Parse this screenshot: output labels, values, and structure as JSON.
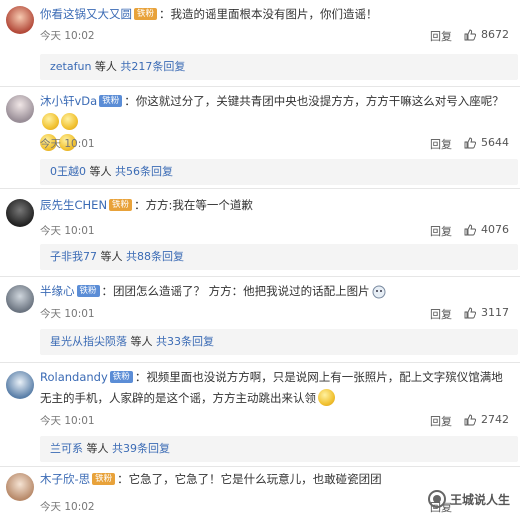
{
  "comments": [
    {
      "user": "你看这锅又大又圆",
      "badge": "",
      "separator": "：",
      "text": "我造的谣里面根本没有图片，你们造谣！",
      "time": "今天 10:02",
      "reply_label": "回复",
      "likes": "8672",
      "thread": {
        "user": "zetafun",
        "mid": " 等人 ",
        "count": "共217条回复"
      }
    },
    {
      "user": "沐小轩vDa",
      "badge": "铁粉",
      "separator": "：",
      "text": "你这就过分了，关键共青团中央也没提方方，方方干嘛这么对号入座呢？",
      "time": "今天 10:01",
      "reply_label": "回复",
      "likes": "5644",
      "thread": {
        "user": "0王越0",
        "mid": " 等人 ",
        "count": "共56条回复"
      }
    },
    {
      "user": "辰先生CHEN",
      "badge": "",
      "separator": "：",
      "text": "方方:我在等一个道歉",
      "time": "今天 10:01",
      "reply_label": "回复",
      "likes": "4076",
      "thread": {
        "user": "子非我77",
        "mid": " 等人 ",
        "count": "共88条回复"
      }
    },
    {
      "user": "半缘心",
      "badge": "铁粉",
      "separator": "：",
      "text": "团团怎么造谣了？ 方方：他把我说过的话配上图片",
      "time": "今天 10:01",
      "reply_label": "回复",
      "likes": "3117",
      "thread": {
        "user": "星光从指尖陨落",
        "mid": " 等人 ",
        "count": "共33条回复"
      }
    },
    {
      "user": "Rolandandy",
      "badge": "铁粉",
      "separator": "：",
      "text": "视频里面也没说方方啊，只是说网上有一张照片，配上文字殡仪馆满地无主的手机，人家辟的是这个谣，方方主动跳出来认领",
      "time": "今天 10:01",
      "reply_label": "回复",
      "likes": "2742",
      "thread": {
        "user": "兰可系",
        "mid": " 等人 ",
        "count": "共39条回复"
      }
    },
    {
      "user": "木子欣-思",
      "badge": "",
      "separator": "：",
      "text": "它急了，它急了！它是什么玩意儿，也敢碰瓷团团",
      "time": "今天 10:02",
      "reply_label": "回复",
      "likes": "",
      "thread": null
    }
  ],
  "watermark": {
    "text": "王城说人生"
  },
  "icons": {
    "like": "thumbs-up-icon",
    "emoji": "smile-emoji-icon",
    "watermark": "wechat-logo-icon"
  }
}
